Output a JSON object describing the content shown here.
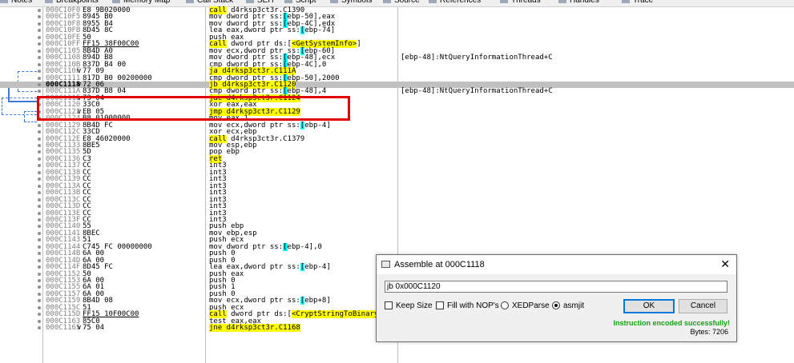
{
  "tabs": [
    {
      "label": "Notes",
      "icon": "notes-icon"
    },
    {
      "label": "Breakpoints",
      "icon": "breakpoint-icon"
    },
    {
      "label": "Memory Map",
      "icon": "memory-map-icon"
    },
    {
      "label": "Call Stack",
      "icon": "call-stack-icon"
    },
    {
      "label": "SEH",
      "icon": "seh-icon"
    },
    {
      "label": "Script",
      "icon": "script-icon"
    },
    {
      "label": "Symbols",
      "icon": "symbols-icon"
    },
    {
      "label": "Source",
      "icon": "source-icon"
    },
    {
      "label": "References",
      "icon": "references-icon"
    },
    {
      "label": "Threads",
      "icon": "threads-icon"
    },
    {
      "label": "Handles",
      "icon": "handles-icon"
    },
    {
      "label": "Trace",
      "icon": "trace-icon"
    }
  ],
  "disassembly": {
    "selected_address": "000C1118",
    "rows": [
      {
        "addr": "000C10F0",
        "arrow": "",
        "hex": "E8 9B020000",
        "ins": [
          {
            "t": "call",
            "c": "y"
          },
          {
            "t": " d4rksp3ct3r.C1390"
          }
        ],
        "cmt": ""
      },
      {
        "addr": "000C10F5",
        "arrow": "",
        "hex": "8945 B0",
        "ins": [
          {
            "t": "mov dword ptr ss:"
          },
          {
            "t": "[",
            "c": "c"
          },
          {
            "t": "ebp-50"
          },
          {
            "t": "]"
          },
          {
            "t": ",eax"
          }
        ],
        "cmt": ""
      },
      {
        "addr": "000C10F8",
        "arrow": "",
        "hex": "8955 B4",
        "ins": [
          {
            "t": "mov dword ptr ss:"
          },
          {
            "t": "[",
            "c": "c"
          },
          {
            "t": "ebp-4C"
          },
          {
            "t": "]"
          },
          {
            "t": ",edx"
          }
        ],
        "cmt": ""
      },
      {
        "addr": "000C10FB",
        "arrow": "",
        "hex": "8D45 8C",
        "ins": [
          {
            "t": "lea eax,dword ptr ss:"
          },
          {
            "t": "[",
            "c": "c"
          },
          {
            "t": "ebp-74"
          },
          {
            "t": "]"
          }
        ],
        "cmt": ""
      },
      {
        "addr": "000C10FE",
        "arrow": "",
        "hex": "50",
        "ins": [
          {
            "t": "push eax"
          }
        ],
        "cmt": ""
      },
      {
        "addr": "000C10FF",
        "arrow": "",
        "hex": "FF15 38F00C00",
        "hexul": true,
        "ins": [
          {
            "t": "call",
            "c": "y"
          },
          {
            "t": " dword ptr ds:["
          },
          {
            "t": "<GetSystemInfo>",
            "c": "y"
          },
          {
            "t": "]"
          }
        ],
        "cmt": ""
      },
      {
        "addr": "000C1105",
        "arrow": "",
        "hex": "8B4D A0",
        "ins": [
          {
            "t": "mov ecx,dword ptr ss:"
          },
          {
            "t": "[",
            "c": "c"
          },
          {
            "t": "ebp-60"
          },
          {
            "t": "]"
          }
        ],
        "cmt": ""
      },
      {
        "addr": "000C1108",
        "arrow": "",
        "hex": "894D B8",
        "ins": [
          {
            "t": "mov dword ptr ss:"
          },
          {
            "t": "[",
            "c": "c"
          },
          {
            "t": "ebp-48"
          },
          {
            "t": "]"
          },
          {
            "t": ",ecx"
          }
        ],
        "cmt": "[ebp-48]:NtQueryInformationThread+C"
      },
      {
        "addr": "000C110B",
        "arrow": "",
        "hex": "837D B4 00",
        "ins": [
          {
            "t": "cmp dword ptr ss:"
          },
          {
            "t": "[",
            "c": "c"
          },
          {
            "t": "ebp-4C"
          },
          {
            "t": "]"
          },
          {
            "t": ",0"
          }
        ],
        "cmt": ""
      },
      {
        "addr": "000C110F",
        "arrow": "v",
        "hex": "77 09",
        "ins": [
          {
            "t": "ja d4rksp3ct3r.C111A",
            "c": "y"
          }
        ],
        "cmt": ""
      },
      {
        "addr": "000C1111",
        "arrow": "",
        "hex": "817D B0 00200000",
        "ins": [
          {
            "t": "cmp dword ptr ss:"
          },
          {
            "t": "[",
            "c": "c"
          },
          {
            "t": "ebp-50"
          },
          {
            "t": "]"
          },
          {
            "t": ",2000"
          }
        ],
        "cmt": ""
      },
      {
        "addr": "000C1118",
        "arrow": "v",
        "hex": "72 06",
        "ins": [
          {
            "t": "jb d4rksp3ct3r.C1120",
            "c": "y"
          }
        ],
        "cmt": "",
        "sel": true
      },
      {
        "addr": "000C111A",
        "arrow": "",
        "hex": "837D B8 04",
        "ins": [
          {
            "t": "cmp dword ptr ss:"
          },
          {
            "t": "[",
            "c": "c"
          },
          {
            "t": "ebp-48"
          },
          {
            "t": "]"
          },
          {
            "t": ",4"
          }
        ],
        "cmt": "[ebp-48]:NtQueryInformationThread+C"
      },
      {
        "addr": "000C111E",
        "arrow": "v",
        "hex": "73 04",
        "ins": [
          {
            "t": "jae d4rksp3ct3r.C1124",
            "c": "y"
          }
        ],
        "cmt": ""
      },
      {
        "addr": "000C1120",
        "arrow": "",
        "hex": "33C0",
        "ins": [
          {
            "t": "xor eax,eax"
          }
        ],
        "cmt": ""
      },
      {
        "addr": "000C1122",
        "arrow": "v",
        "hex": "EB 05",
        "ins": [
          {
            "t": "jmp d4rksp3ct3r.C1129",
            "c": "y"
          }
        ],
        "cmt": ""
      },
      {
        "addr": "000C1124",
        "arrow": "",
        "hex": "B8 01000000",
        "ins": [
          {
            "t": "mov eax,1"
          }
        ],
        "cmt": ""
      },
      {
        "addr": "000C1129",
        "arrow": "",
        "hex": "8B4D FC",
        "ins": [
          {
            "t": "mov ecx,dword ptr ss:"
          },
          {
            "t": "[",
            "c": "c"
          },
          {
            "t": "ebp-4"
          },
          {
            "t": "]"
          }
        ],
        "cmt": ""
      },
      {
        "addr": "000C112C",
        "arrow": "",
        "hex": "33CD",
        "ins": [
          {
            "t": "xor ecx,ebp"
          }
        ],
        "cmt": ""
      },
      {
        "addr": "000C112E",
        "arrow": "",
        "hex": "E8 46020000",
        "ins": [
          {
            "t": "call",
            "c": "y"
          },
          {
            "t": " d4rksp3ct3r.C1379"
          }
        ],
        "cmt": ""
      },
      {
        "addr": "000C1133",
        "arrow": "",
        "hex": "8BE5",
        "ins": [
          {
            "t": "mov esp,ebp"
          }
        ],
        "cmt": ""
      },
      {
        "addr": "000C1135",
        "arrow": "",
        "hex": "5D",
        "ins": [
          {
            "t": "pop ebp"
          }
        ],
        "cmt": ""
      },
      {
        "addr": "000C1136",
        "arrow": "",
        "hex": "C3",
        "ins": [
          {
            "t": "ret",
            "c": "y"
          }
        ],
        "cmt": ""
      },
      {
        "addr": "000C1137",
        "arrow": "",
        "hex": "CC",
        "ins": [
          {
            "t": "int3"
          }
        ],
        "cmt": ""
      },
      {
        "addr": "000C1138",
        "arrow": "",
        "hex": "CC",
        "ins": [
          {
            "t": "int3"
          }
        ],
        "cmt": ""
      },
      {
        "addr": "000C1139",
        "arrow": "",
        "hex": "CC",
        "ins": [
          {
            "t": "int3"
          }
        ],
        "cmt": ""
      },
      {
        "addr": "000C113A",
        "arrow": "",
        "hex": "CC",
        "ins": [
          {
            "t": "int3"
          }
        ],
        "cmt": ""
      },
      {
        "addr": "000C113B",
        "arrow": "",
        "hex": "CC",
        "ins": [
          {
            "t": "int3"
          }
        ],
        "cmt": ""
      },
      {
        "addr": "000C113C",
        "arrow": "",
        "hex": "CC",
        "ins": [
          {
            "t": "int3"
          }
        ],
        "cmt": ""
      },
      {
        "addr": "000C113D",
        "arrow": "",
        "hex": "CC",
        "ins": [
          {
            "t": "int3"
          }
        ],
        "cmt": ""
      },
      {
        "addr": "000C113E",
        "arrow": "",
        "hex": "CC",
        "ins": [
          {
            "t": "int3"
          }
        ],
        "cmt": ""
      },
      {
        "addr": "000C113F",
        "arrow": "",
        "hex": "CC",
        "ins": [
          {
            "t": "int3"
          }
        ],
        "cmt": ""
      },
      {
        "addr": "000C1140",
        "arrow": "",
        "hex": "55",
        "ins": [
          {
            "t": "push ebp"
          }
        ],
        "cmt": ""
      },
      {
        "addr": "000C1141",
        "arrow": "",
        "hex": "8BEC",
        "ins": [
          {
            "t": "mov ebp,esp"
          }
        ],
        "cmt": ""
      },
      {
        "addr": "000C1143",
        "arrow": "",
        "hex": "51",
        "ins": [
          {
            "t": "push ecx"
          }
        ],
        "cmt": ""
      },
      {
        "addr": "000C1144",
        "arrow": "",
        "hex": "C745 FC 00000000",
        "ins": [
          {
            "t": "mov dword ptr ss:"
          },
          {
            "t": "[",
            "c": "c"
          },
          {
            "t": "ebp-4"
          },
          {
            "t": "]"
          },
          {
            "t": ",0"
          }
        ],
        "cmt": ""
      },
      {
        "addr": "000C114B",
        "arrow": "",
        "hex": "6A 00",
        "ins": [
          {
            "t": "push 0"
          }
        ],
        "cmt": ""
      },
      {
        "addr": "000C114D",
        "arrow": "",
        "hex": "6A 00",
        "ins": [
          {
            "t": "push 0"
          }
        ],
        "cmt": ""
      },
      {
        "addr": "000C114F",
        "arrow": "",
        "hex": "8D45 FC",
        "ins": [
          {
            "t": "lea eax,dword ptr ss:"
          },
          {
            "t": "[",
            "c": "c"
          },
          {
            "t": "ebp-4"
          },
          {
            "t": "]"
          }
        ],
        "cmt": ""
      },
      {
        "addr": "000C1152",
        "arrow": "",
        "hex": "50",
        "ins": [
          {
            "t": "push eax"
          }
        ],
        "cmt": ""
      },
      {
        "addr": "000C1153",
        "arrow": "",
        "hex": "6A 00",
        "ins": [
          {
            "t": "push 0"
          }
        ],
        "cmt": ""
      },
      {
        "addr": "000C1155",
        "arrow": "",
        "hex": "6A 01",
        "ins": [
          {
            "t": "push 1"
          }
        ],
        "cmt": ""
      },
      {
        "addr": "000C1157",
        "arrow": "",
        "hex": "6A 00",
        "ins": [
          {
            "t": "push 0"
          }
        ],
        "cmt": ""
      },
      {
        "addr": "000C1159",
        "arrow": "",
        "hex": "8B4D 08",
        "ins": [
          {
            "t": "mov ecx,dword ptr ss:"
          },
          {
            "t": "[",
            "c": "c"
          },
          {
            "t": "ebp+8"
          },
          {
            "t": "]"
          }
        ],
        "cmt": ""
      },
      {
        "addr": "000C115C",
        "arrow": "",
        "hex": "51",
        "ins": [
          {
            "t": "push ecx"
          }
        ],
        "cmt": ""
      },
      {
        "addr": "000C115D",
        "arrow": "",
        "hex": "FF15 10F00C00",
        "hexul": true,
        "ins": [
          {
            "t": "call",
            "c": "y"
          },
          {
            "t": " dword ptr ds:["
          },
          {
            "t": "<CryptStringToBinary",
            "c": "y"
          }
        ],
        "cmt": ""
      },
      {
        "addr": "000C1163",
        "arrow": "",
        "hex": "85C0",
        "ins": [
          {
            "t": "test eax,eax"
          }
        ],
        "cmt": ""
      },
      {
        "addr": "000C1165",
        "arrow": "v",
        "hex": "75 04",
        "ins": [
          {
            "t": "jne d4rksp3ct3r.C1168",
            "c": "y"
          }
        ],
        "cmt": ""
      }
    ]
  },
  "dialog": {
    "title": "Assemble at 000C1118",
    "close_label": "✕",
    "input_value": "jb 0x000C1120",
    "keep_size_label": "Keep Size",
    "keep_size_checked": false,
    "fill_nops_label": "Fill with NOP's",
    "fill_nops_checked": false,
    "xedparse_label": "XEDParse",
    "asmjit_label": "asmjit",
    "selected_engine": "asmjit",
    "ok_label": "OK",
    "cancel_label": "Cancel",
    "status_message": "Instruction encoded successfully!",
    "status_color": "#14a014",
    "bytes_label": "Bytes: 7206"
  }
}
